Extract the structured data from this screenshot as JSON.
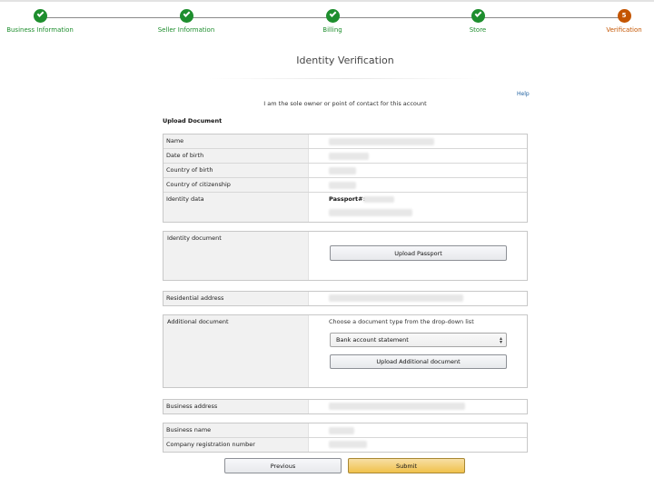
{
  "stepper": {
    "steps": [
      {
        "label": "Business Information",
        "state": "done"
      },
      {
        "label": "Seller Information",
        "state": "done"
      },
      {
        "label": "Billing",
        "state": "done"
      },
      {
        "label": "Store",
        "state": "done"
      },
      {
        "label": "Verification",
        "state": "current",
        "number": "5"
      }
    ],
    "done_color": "#1e8e2e",
    "current_color": "#c45500"
  },
  "page": {
    "title": "Identity Verification",
    "help_link": "Help",
    "sole_owner_text": "I am the sole owner or point of contact for this account",
    "upload_heading": "Upload Document"
  },
  "identity_table": {
    "name_label": "Name",
    "dob_label": "Date of birth",
    "country_birth_label": "Country of birth",
    "country_citizenship_label": "Country of citizenship",
    "identity_data_label": "Identity data",
    "passport_label": "Passport#:"
  },
  "identity_document": {
    "label": "Identity document",
    "upload_button": "Upload Passport"
  },
  "residential": {
    "label": "Residential address"
  },
  "additional_document": {
    "label": "Additional document",
    "hint": "Choose a document type from the drop-down list",
    "selected_type": "Bank account statement",
    "upload_button": "Upload Additional document"
  },
  "business_address": {
    "label": "Business address"
  },
  "business_info": {
    "name_label": "Business name",
    "registration_label": "Company registration number"
  },
  "actions": {
    "previous": "Previous",
    "submit": "Submit",
    "submit_color": "#f0c14b"
  }
}
